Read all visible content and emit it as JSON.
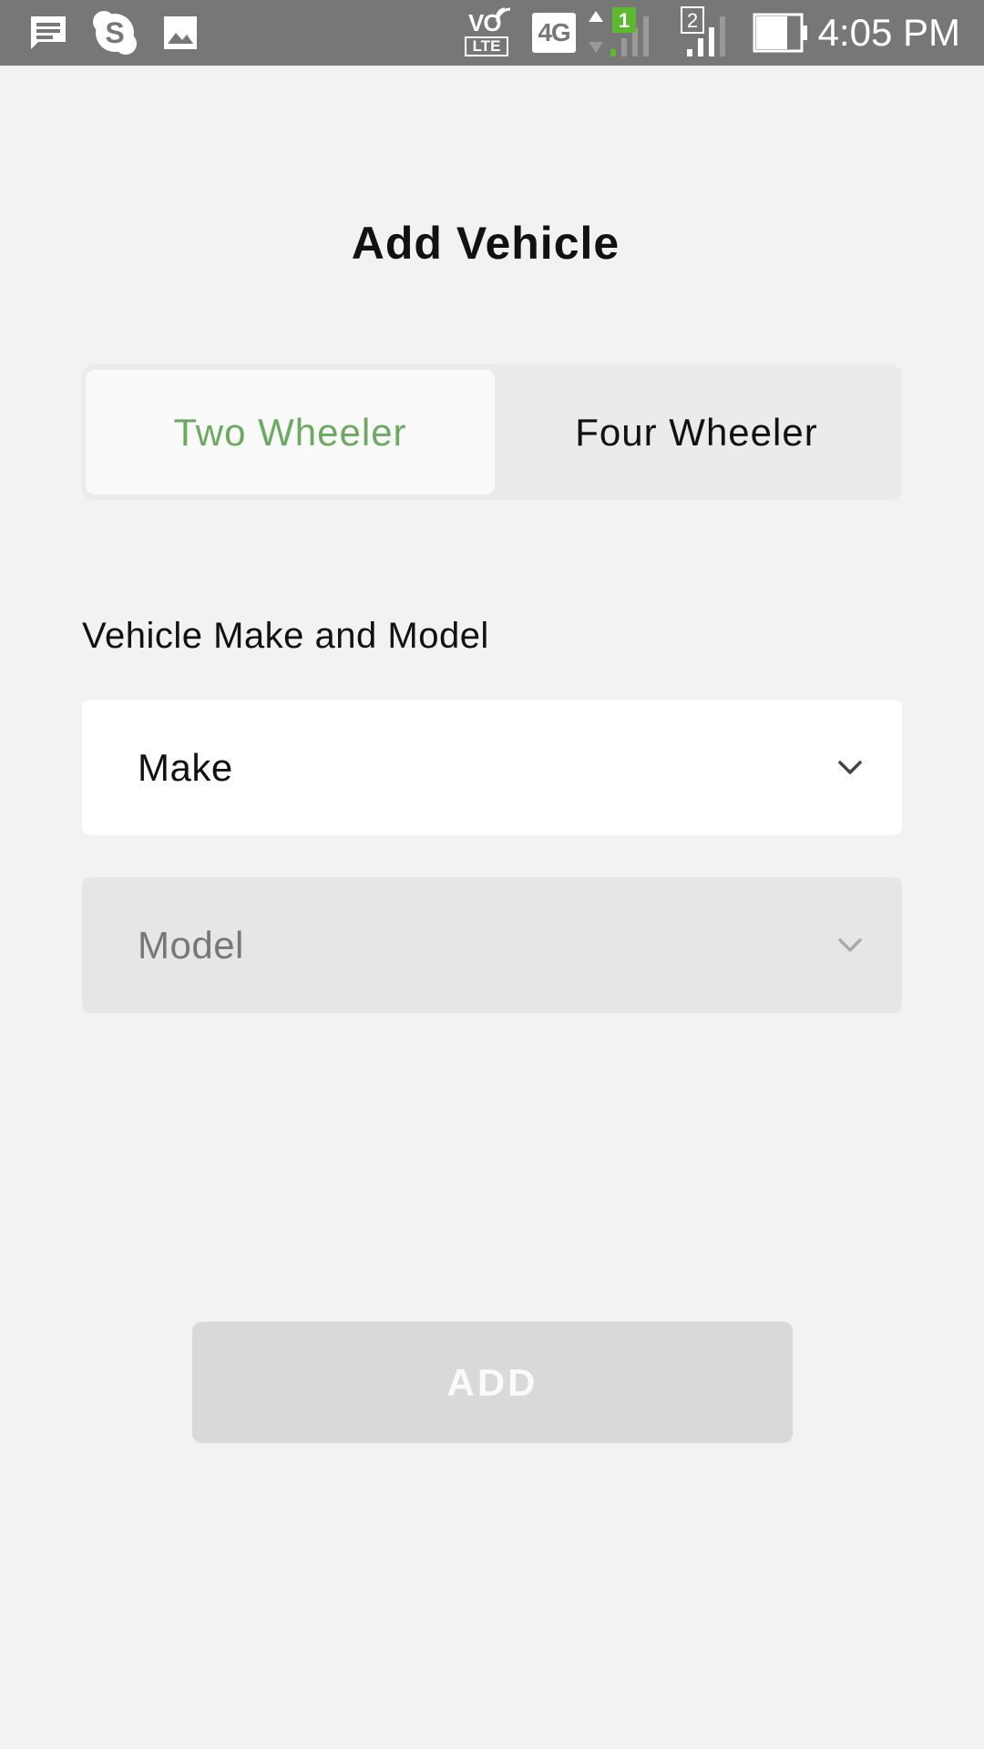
{
  "status_bar": {
    "time": "4:05 PM",
    "volte_top": "VO",
    "volte_bottom": "LTE",
    "network": "4G",
    "sim1_badge": "1",
    "sim2_badge": "2",
    "icons": [
      "message-icon",
      "skype-icon",
      "image-icon",
      "volte-icon",
      "4g-icon",
      "data-arrows-icon",
      "signal-sim1-icon",
      "signal-sim2-icon",
      "battery-icon"
    ],
    "accent_sim1": "#5cb82c"
  },
  "page": {
    "title": "Add Vehicle"
  },
  "vehicle_type": {
    "options": [
      {
        "label": "Two Wheeler",
        "selected": true
      },
      {
        "label": "Four Wheeler",
        "selected": false
      }
    ],
    "active_color": "#6aab60"
  },
  "make_model": {
    "section_label": "Vehicle Make and Model",
    "make_placeholder": "Make",
    "model_placeholder": "Model",
    "model_enabled": false
  },
  "actions": {
    "add_label": "ADD",
    "add_enabled": false
  }
}
